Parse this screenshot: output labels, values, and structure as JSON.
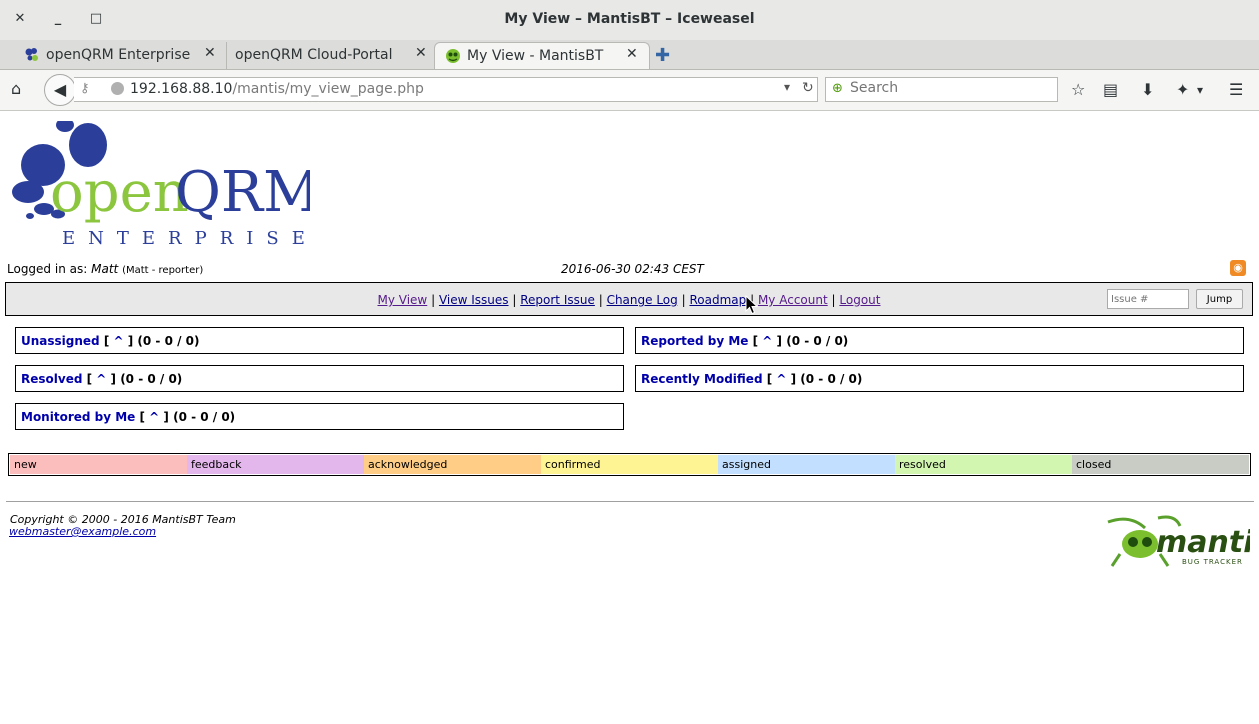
{
  "window": {
    "title": "My View – MantisBT – Iceweasel",
    "close": "✕",
    "minimize": "_",
    "maximize": "□"
  },
  "tabs": [
    {
      "label": "openQRM Enterprise ...",
      "close": "✕"
    },
    {
      "label": "openQRM Cloud-Portal",
      "close": "✕"
    },
    {
      "label": "My View - MantisBT",
      "close": "✕",
      "active": true
    }
  ],
  "new_tab": "✚",
  "nav": {
    "home": "⌂",
    "back": "◀",
    "url_host": "192.168.88.10",
    "url_path": "/mantis/my_view_page.php",
    "search_placeholder": "Search",
    "reload": "↻",
    "dropdown": "▾"
  },
  "page": {
    "logo": {
      "main": "openQRM",
      "open": "open",
      "qrm": "QRM",
      "sub": "ENTERPRISE"
    },
    "logged_in_label": "Logged in as:",
    "user": "Matt",
    "user_role": "(Matt - reporter)",
    "datetime": "2016-06-30 02:43 CEST",
    "menu": [
      {
        "label": "My View",
        "visited": true
      },
      {
        "label": "View Issues",
        "visited": false
      },
      {
        "label": "Report Issue",
        "visited": false
      },
      {
        "label": "Change Log",
        "visited": false
      },
      {
        "label": "Roadmap",
        "visited": false
      },
      {
        "label": "My Account",
        "visited": true
      },
      {
        "label": "Logout",
        "visited": true
      }
    ],
    "menu_separator": "|",
    "issue_placeholder": "Issue #",
    "jump_label": "Jump",
    "boxes": {
      "unassigned": {
        "title": "Unassigned",
        "caret": "^",
        "counts": "(0 - 0 / 0)"
      },
      "reported": {
        "title": "Reported by Me",
        "caret": "^",
        "counts": "(0 - 0 / 0)"
      },
      "resolved": {
        "title": "Resolved",
        "caret": "^",
        "counts": "(0 - 0 / 0)"
      },
      "modified": {
        "title": "Recently Modified",
        "caret": "^",
        "counts": "(0 - 0 / 0)"
      },
      "monitored": {
        "title": "Monitored by Me",
        "caret": "^",
        "counts": "(0 - 0 / 0)"
      }
    },
    "status_legend": [
      {
        "label": "new",
        "color": "#fcbdbd"
      },
      {
        "label": "feedback",
        "color": "#e3b7eb"
      },
      {
        "label": "acknowledged",
        "color": "#ffcd85"
      },
      {
        "label": "confirmed",
        "color": "#fff494"
      },
      {
        "label": "assigned",
        "color": "#c2dfff"
      },
      {
        "label": "resolved",
        "color": "#d2f5b0"
      },
      {
        "label": "closed",
        "color": "#c9ccc4"
      }
    ],
    "footer": {
      "copyright": "Copyright © 2000 - 2016 MantisBT Team",
      "email": "webmaster@example.com",
      "mantis_logo": "mantis",
      "mantis_sub": "BUG TRACKER"
    }
  }
}
